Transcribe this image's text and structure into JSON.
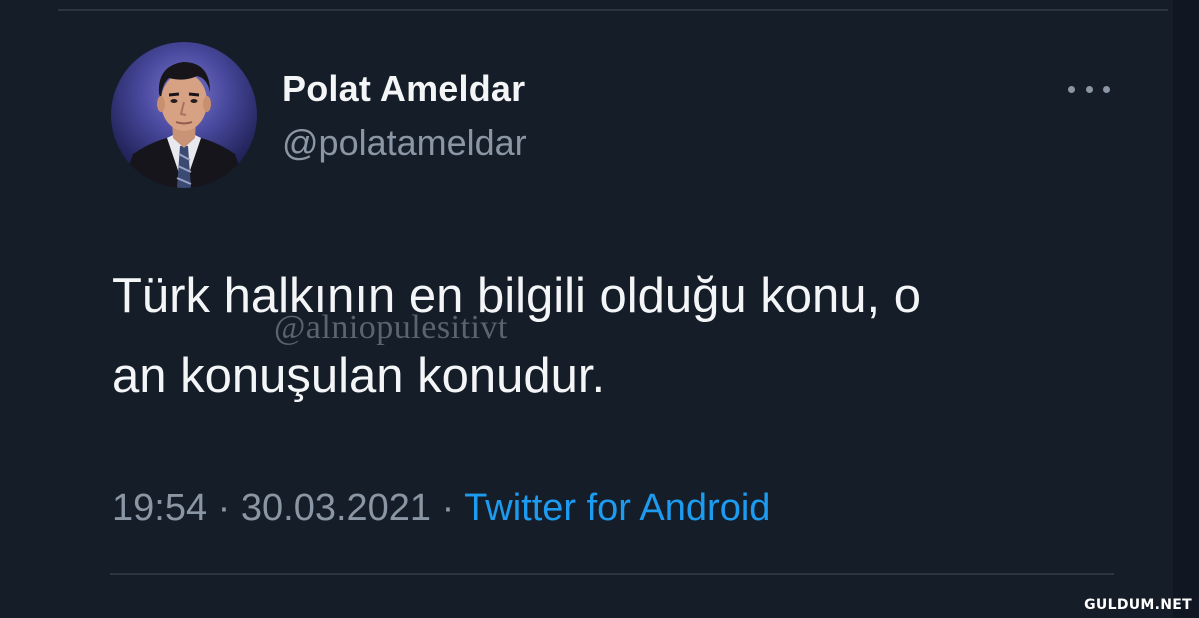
{
  "tweet": {
    "author": {
      "display_name": "Polat Ameldar",
      "handle": "@polatameldar",
      "avatar_icon": "profile-photo"
    },
    "text_line1": "Türk halkının en bilgili olduğu konu, o",
    "text_line2": "an konuşulan konudur.",
    "time": "19:54",
    "date": "30.03.2021",
    "separator": "·",
    "source": "Twitter for Android",
    "more_icon": "more-horizontal-icon"
  },
  "overlay": {
    "watermark_handle": "@alniopulesitivt",
    "site_mark": "GULDUM.NET"
  },
  "colors": {
    "background": "#151d28",
    "primary_text": "#f3f5f7",
    "secondary_text": "#8a96a3",
    "link": "#1d9bf0",
    "divider": "#2b3440"
  }
}
